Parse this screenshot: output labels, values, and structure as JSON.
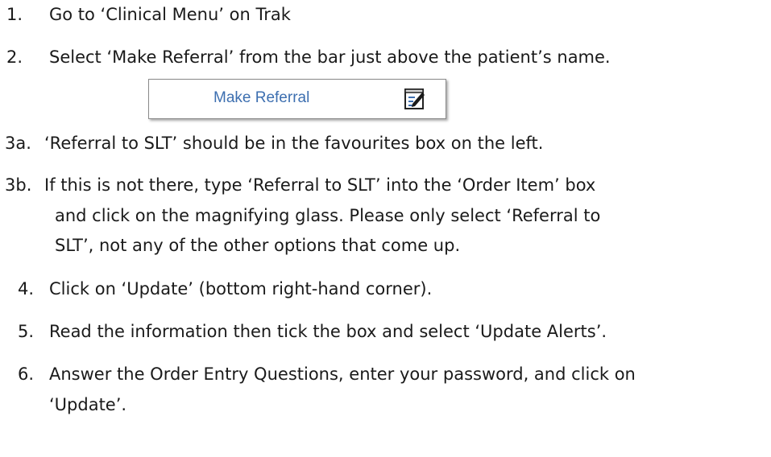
{
  "steps": [
    {
      "num": "1.",
      "text": "Go to ‘Clinical Menu’ on Trak"
    },
    {
      "num": "2.",
      "text": "Select ‘Make Referral’ from the bar just above the patient’s name."
    },
    {
      "num": "3a.",
      "text": "‘Referral to SLT’ should be in the favourites box on the left."
    },
    {
      "num": "3b.",
      "text": "If this is not there, type ‘Referral to SLT’ into the ‘Order Item’ box",
      "cont": [
        "and click on the magnifying glass. Please only select ‘Referral to",
        "SLT’, not any of the other options that come up."
      ]
    },
    {
      "num": "4.",
      "text": "Click on ‘Update’ (bottom right-hand corner)."
    },
    {
      "num": "5.",
      "text": "Read the information then tick the box and select ‘Update Alerts’."
    },
    {
      "num": "6.",
      "text": "Answer the Order Entry Questions, enter your password, and click on",
      "cont": [
        "‘Update’."
      ]
    }
  ],
  "make_referral_button": {
    "label": "Make Referral",
    "icon": "edit-notepad-icon"
  }
}
